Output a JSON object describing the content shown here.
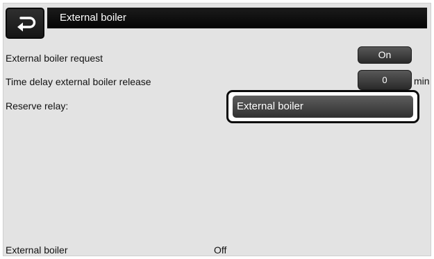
{
  "header": {
    "title": "External boiler"
  },
  "settings": {
    "request_label": "External boiler request",
    "request_value": "On",
    "delay_label": "Time delay external boiler release",
    "delay_value": "0",
    "delay_unit": "min",
    "reserve_label": "Reserve relay:",
    "reserve_value": "External boiler"
  },
  "status": {
    "label": "External boiler",
    "value": "Off"
  }
}
